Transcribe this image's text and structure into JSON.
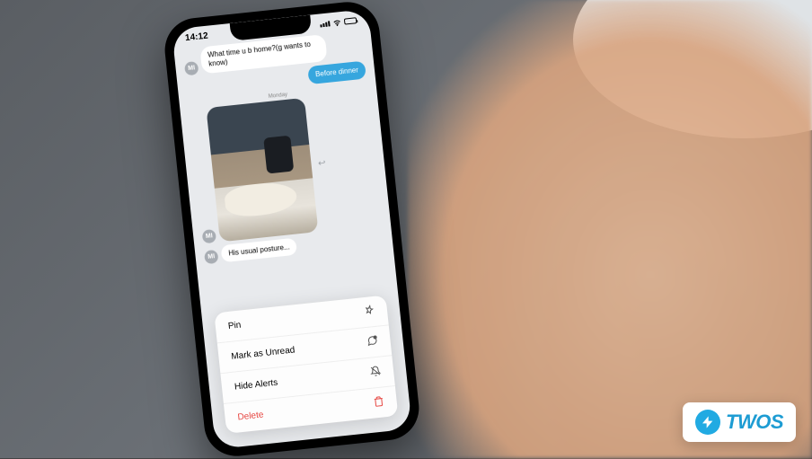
{
  "statusbar": {
    "time": "14:12"
  },
  "conversation": {
    "contact_line": "",
    "incoming1": "What time u b home?(g wants to know)",
    "outgoing1": "Before dinner",
    "timestamp1": "Monday",
    "avatar_initials": "MI",
    "caption": "His usual posture..."
  },
  "context_menu": {
    "pin": "Pin",
    "mark_unread": "Mark as Unread",
    "hide_alerts": "Hide Alerts",
    "delete": "Delete"
  },
  "branding": {
    "text": "TWOS"
  }
}
